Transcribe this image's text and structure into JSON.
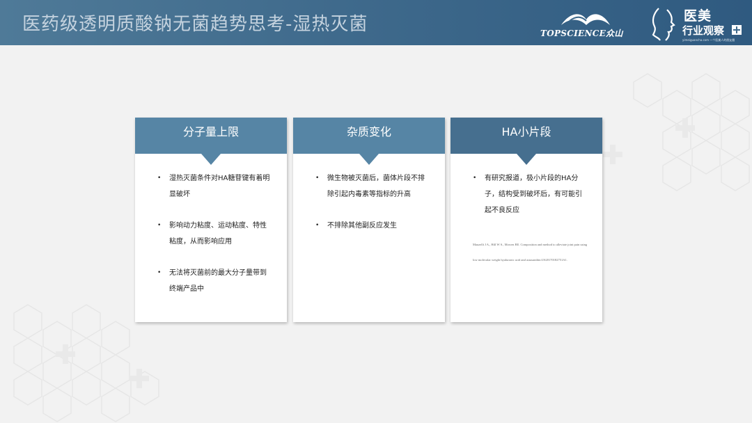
{
  "header": {
    "title": "医药级透明质酸钠无菌趋势思考-湿热灭菌",
    "logo_topscience": {
      "brand": "TOPSCIENCE众山"
    },
    "logo_yimei": {
      "line1": "医美",
      "line2": "行业观察",
      "small": "yimeiguancha.com 一个医美人的朋友圈"
    }
  },
  "cards": [
    {
      "heading": "分子量上限",
      "bullets": [
        "湿热灭菌条件对HA糖苷键有着明显破坏",
        "影响动力粘度、运动粘度、特性粘度，从而影响应用",
        "无法将灭菌前的最大分子量带到终端产品中"
      ]
    },
    {
      "heading": "杂质变化",
      "bullets": [
        "微生物被灭菌后，菌体片段不排除引起内毒素等指标的升高",
        "不排除其他副反应发生"
      ]
    },
    {
      "heading": "HA小片段",
      "bullets": [
        "有研究报道，极小片段的HA分子，结构受到破坏后，有可能引起不良反应"
      ],
      "reference": "Mauzelli J A., Hill W S., Mowen BE. Composition and method to alleviate joint pain using low molecular weight hyaluronic acid and astaxanthin:US20170182751A1."
    }
  ],
  "colors": {
    "header": "#3f6a8c",
    "card_head": "#5685a5",
    "card_head_dark": "#466f8f",
    "background": "#f2f2f2"
  }
}
